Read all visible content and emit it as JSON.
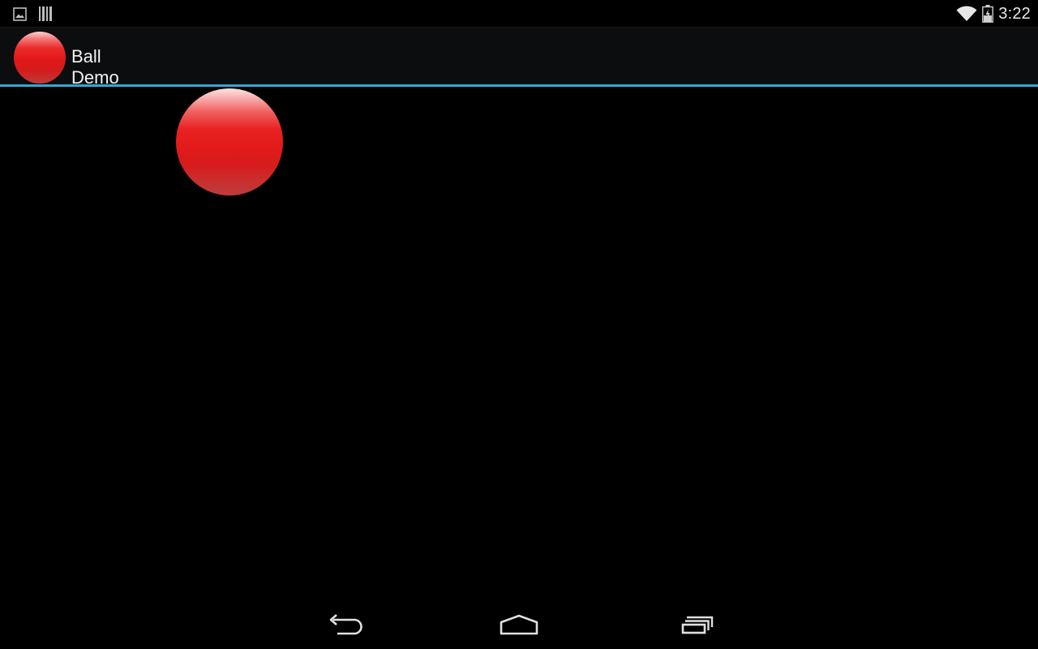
{
  "status_bar": {
    "left_icons": [
      "gallery-notification-icon",
      "barcode-notification-icon"
    ],
    "right_icons": [
      "wifi-icon",
      "battery-icon"
    ],
    "time": "3:22"
  },
  "action_bar": {
    "app_icon": "red-ball-icon",
    "title": "Ball Demo",
    "divider_color": "#33a8d6"
  },
  "content": {
    "background_color": "#000000",
    "ball_color": "#e21a1a"
  },
  "nav_bar": {
    "buttons": [
      "back-icon",
      "home-icon",
      "recent-apps-icon"
    ]
  }
}
